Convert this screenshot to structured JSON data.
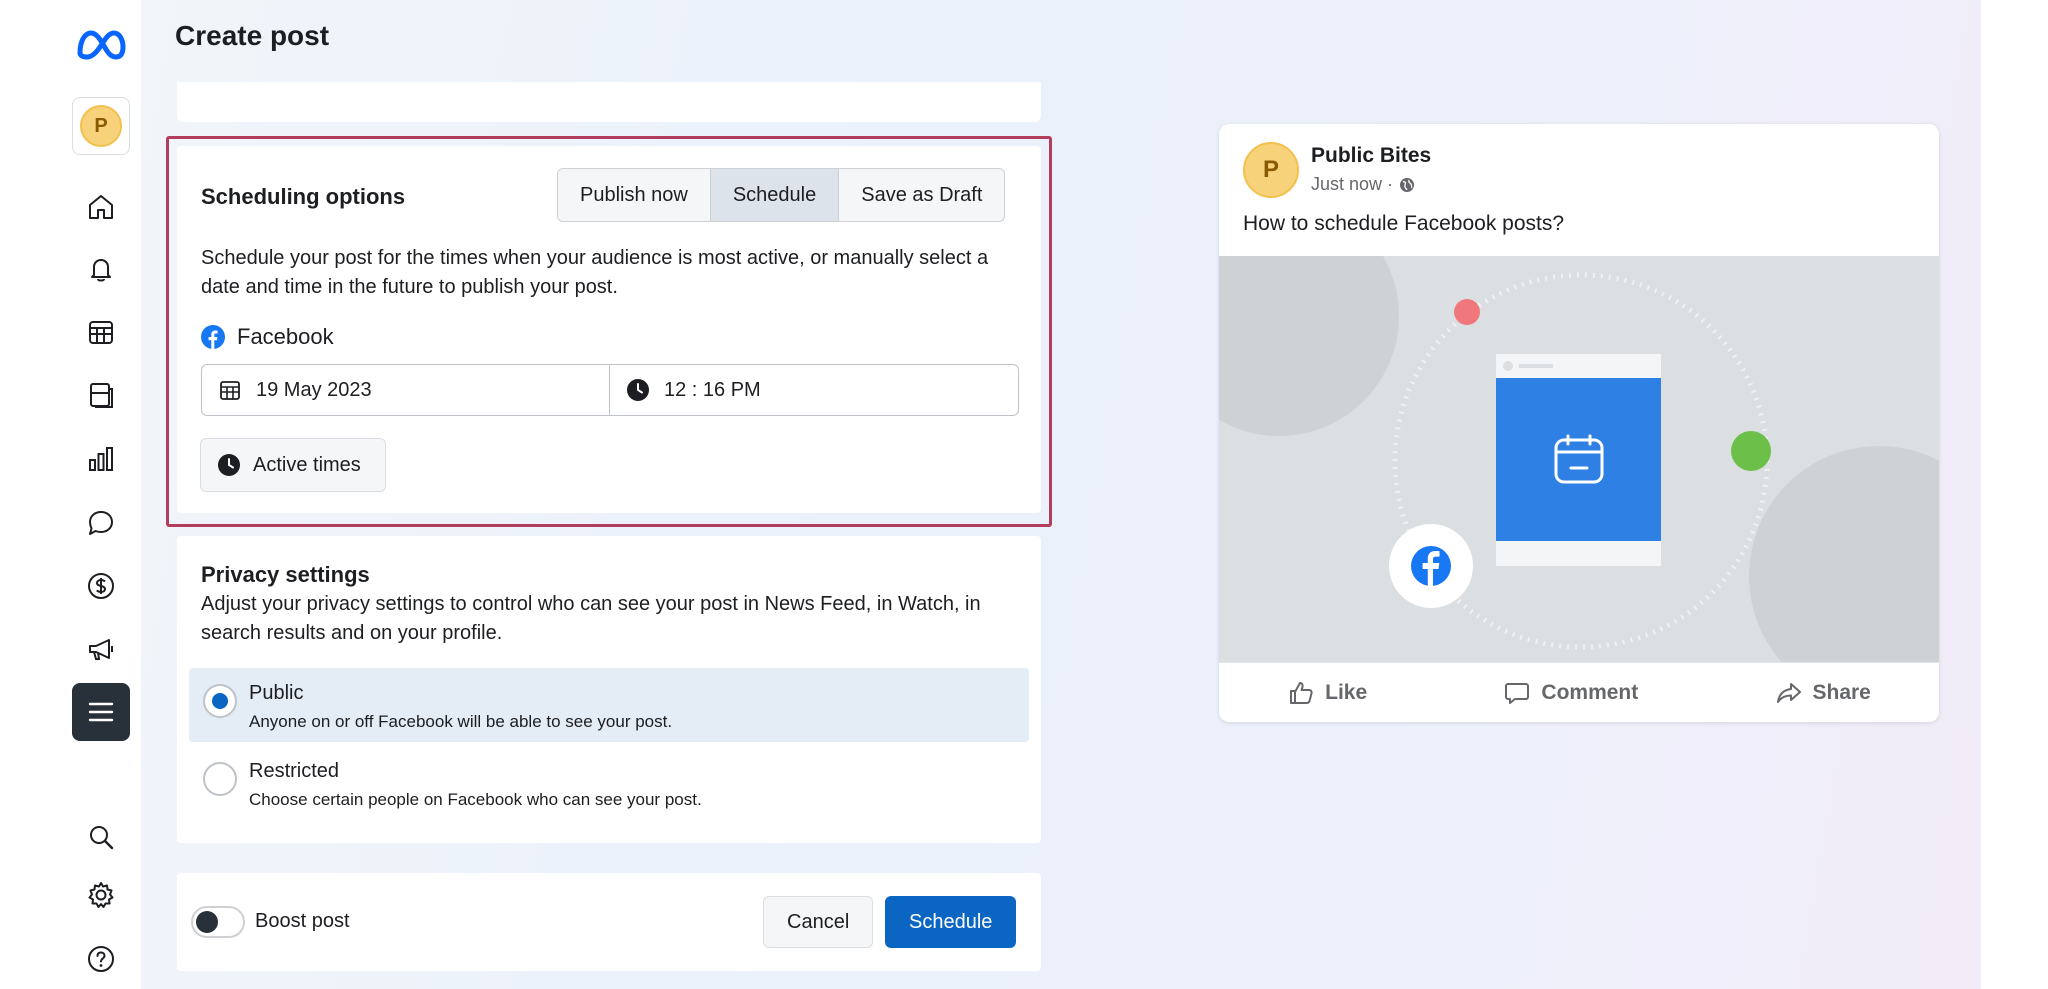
{
  "header": {
    "title": "Create post"
  },
  "sidebar": {
    "avatar_letter": "P",
    "items": [
      {
        "name": "home",
        "icon": "home-icon"
      },
      {
        "name": "notifications",
        "icon": "bell-icon"
      },
      {
        "name": "planner",
        "icon": "calendar-grid-icon"
      },
      {
        "name": "content",
        "icon": "content-icon"
      },
      {
        "name": "insights",
        "icon": "bar-chart-icon"
      },
      {
        "name": "inbox",
        "icon": "chat-bubble-icon"
      },
      {
        "name": "monetization",
        "icon": "dollar-icon"
      },
      {
        "name": "ads",
        "icon": "megaphone-icon"
      },
      {
        "name": "all-tools",
        "icon": "menu-icon"
      },
      {
        "name": "search",
        "icon": "search-icon"
      },
      {
        "name": "settings",
        "icon": "gear-icon"
      },
      {
        "name": "help",
        "icon": "help-icon"
      }
    ]
  },
  "scheduling": {
    "title": "Scheduling options",
    "segments": [
      "Publish now",
      "Schedule",
      "Save as Draft"
    ],
    "active_segment": "Schedule",
    "description": "Schedule your post for the times when your audience is most active, or manually select a date and time in the future to publish your post.",
    "platform": "Facebook",
    "date": "19 May 2023",
    "time": "12 : 16 PM",
    "active_times_label": "Active times"
  },
  "privacy": {
    "title": "Privacy settings",
    "description": "Adjust your privacy settings to control who can see your post in News Feed, in Watch, in search results and on your profile.",
    "options": [
      {
        "label": "Public",
        "sub": "Anyone on or off Facebook will be able to see your post.",
        "selected": true
      },
      {
        "label": "Restricted",
        "sub": "Choose certain people on Facebook who can see your post.",
        "selected": false
      }
    ]
  },
  "footer": {
    "boost_label": "Boost post",
    "cancel_label": "Cancel",
    "schedule_label": "Schedule"
  },
  "preview": {
    "avatar_letter": "P",
    "page_name": "Public Bites",
    "meta": "Just now ·",
    "text": "How to schedule Facebook posts?",
    "actions": [
      "Like",
      "Comment",
      "Share"
    ]
  },
  "colors": {
    "accent": "#0a66c2",
    "highlight": "#b33d5c",
    "facebook": "#1877f2"
  }
}
